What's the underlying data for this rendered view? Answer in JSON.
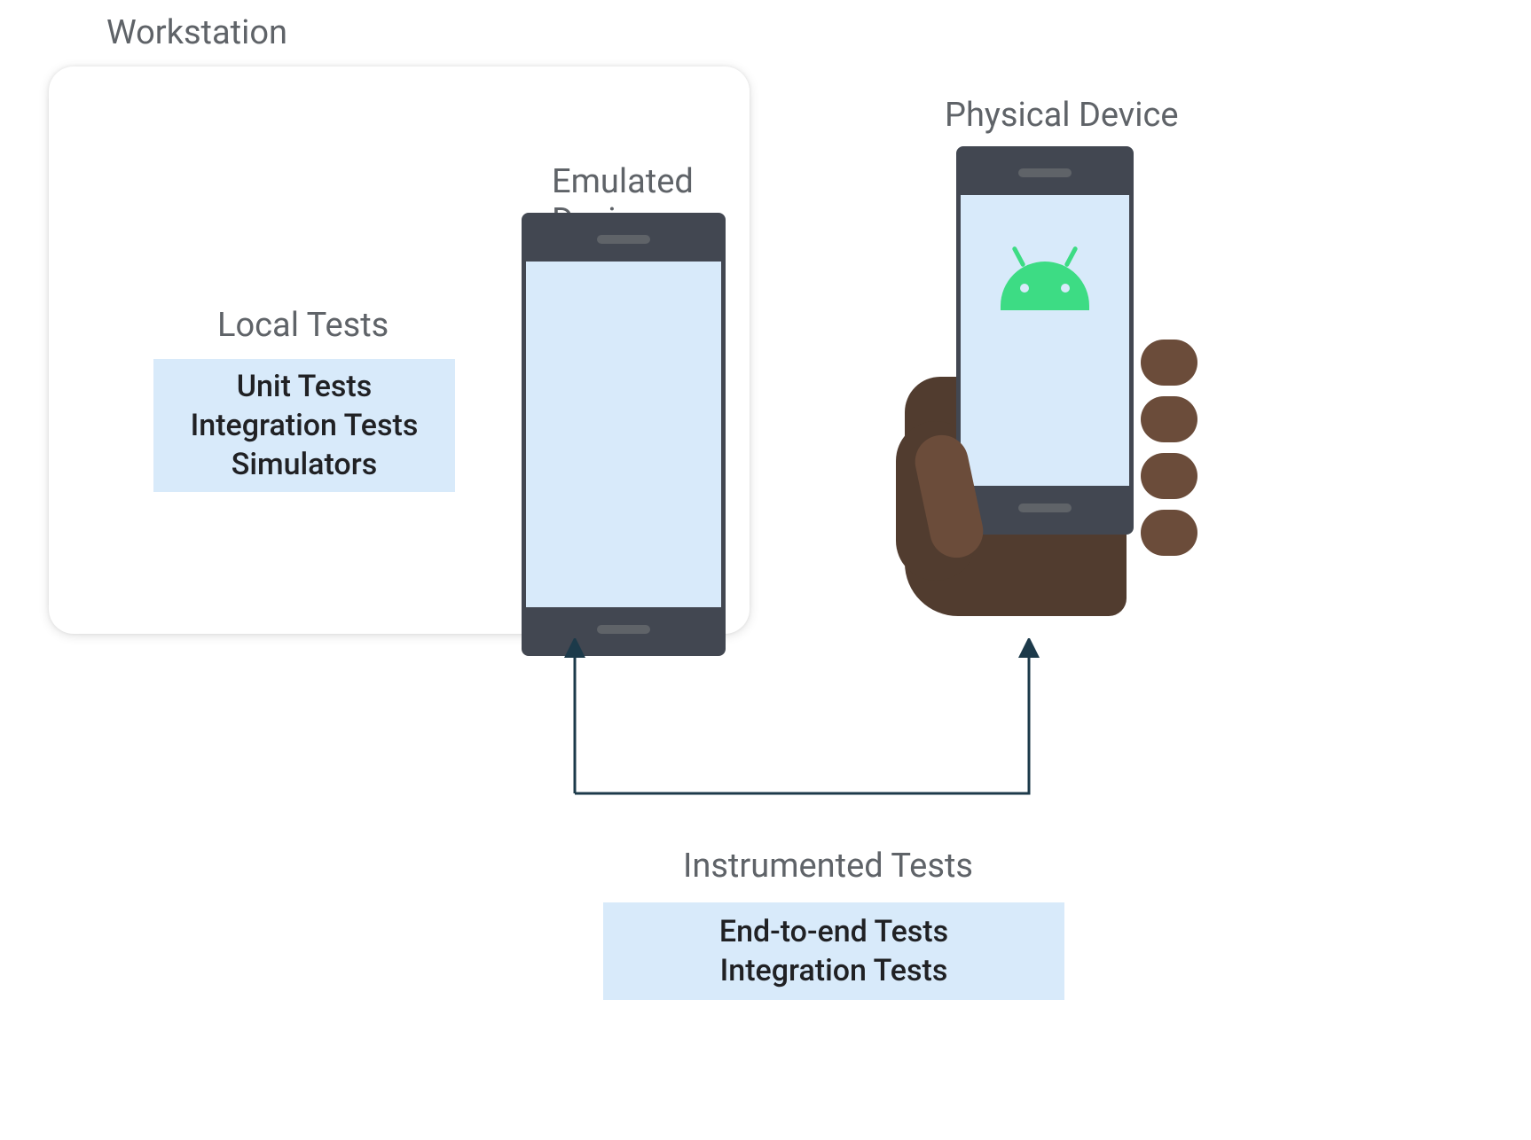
{
  "labels": {
    "workstation": "Workstation",
    "emulated_device": "Emulated Device",
    "physical_device": "Physical Device",
    "local_tests": "Local Tests",
    "instrumented_tests": "Instrumented Tests"
  },
  "local_tests": {
    "line1": "Unit Tests",
    "line2": "Integration Tests",
    "line3": "Simulators"
  },
  "instrumented_tests": {
    "line1": "End-to-end Tests",
    "line2": "Integration Tests"
  },
  "colors": {
    "box_bg": "#d8eafa",
    "text_gray": "#5f6368",
    "text_dark": "#202124",
    "device_frame": "#424751",
    "android_green": "#3ddc84",
    "hand_dark": "#513c2f",
    "hand_light": "#6b4c3a",
    "arrow": "#1c3a4a"
  }
}
